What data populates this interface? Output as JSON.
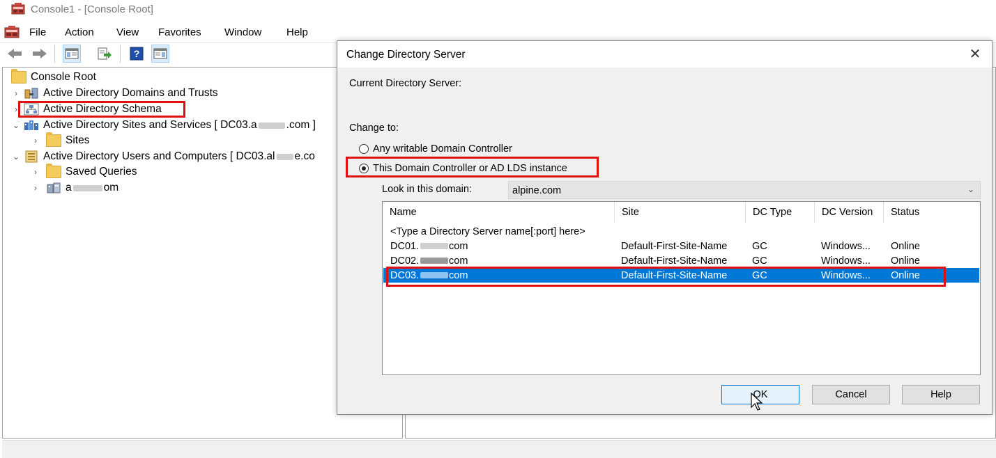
{
  "window": {
    "title": "Console1 - [Console Root]",
    "menu": [
      "File",
      "Action",
      "View",
      "Favorites",
      "Window",
      "Help"
    ]
  },
  "toolbar": {
    "buttons": [
      "back-icon",
      "forward-icon",
      "show-hide-console-tree-icon",
      "export-list-icon",
      "help-icon",
      "show-hide-action-pane-icon"
    ]
  },
  "tree": {
    "root": "Console Root",
    "items": [
      {
        "label": "Active Directory Domains and Trusts"
      },
      {
        "label": "Active Directory Schema"
      },
      {
        "label_prefix": "Active Directory Sites and Services [ DC03.a",
        "label_suffix": ".com ]"
      },
      {
        "label": "Sites"
      },
      {
        "label_prefix": "Active Directory Users and Computers [ DC03.al",
        "label_suffix": "e.co"
      },
      {
        "label": "Saved Queries"
      },
      {
        "label_prefix": "a",
        "label_suffix": "om"
      }
    ]
  },
  "dialog": {
    "title": "Change Directory Server",
    "current_label": "Current Directory Server:",
    "change_to_label": "Change to:",
    "radio_any": "Any writable Domain Controller",
    "radio_this": "This Domain Controller or AD LDS instance",
    "look_in_label": "Look in this domain:",
    "domain_value": "alpine.com",
    "columns": [
      "Name",
      "Site",
      "DC Type",
      "DC Version",
      "Status"
    ],
    "placeholder_row": "<Type a Directory Server name[:port] here>",
    "rows": [
      {
        "name_prefix": "DC01.",
        "name_suffix": "com",
        "site": "Default-First-Site-Name",
        "type": "GC",
        "version": "Windows...",
        "status": "Online"
      },
      {
        "name_prefix": "DC02.",
        "name_suffix": "com",
        "site": "Default-First-Site-Name",
        "type": "GC",
        "version": "Windows...",
        "status": "Online"
      },
      {
        "name_prefix": "DC03.",
        "name_suffix": "com",
        "site": "Default-First-Site-Name",
        "type": "GC",
        "version": "Windows...",
        "status": "Online"
      }
    ],
    "buttons": {
      "ok": "OK",
      "cancel": "Cancel",
      "help": "Help"
    }
  }
}
